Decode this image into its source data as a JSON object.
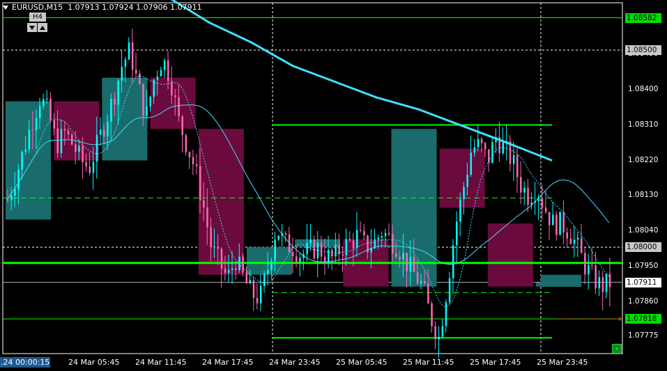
{
  "header": {
    "symbol_timeframe": "EURUSD,M15",
    "ohlc": "1.07913 1.07924 1.07906 1.07911",
    "higher_tf": "H4"
  },
  "price_scale": {
    "labels": [
      "1.08490",
      "1.08400",
      "1.08310",
      "1.08220",
      "1.08130",
      "1.08040",
      "1.07950",
      "1.07860",
      "1.07775"
    ],
    "boxes": [
      {
        "text": "1.08582",
        "price": 1.08582,
        "bg": "#00dd00",
        "fg": "#000000"
      },
      {
        "text": "1.08500",
        "price": 1.085,
        "bg": "#c8c8c8",
        "fg": "#000000"
      },
      {
        "text": "1.08000",
        "price": 1.08,
        "bg": "#c8c8c8",
        "fg": "#000000"
      },
      {
        "text": "1.07911",
        "price": 1.07911,
        "bg": "#ffffff",
        "fg": "#000000"
      },
      {
        "text": "1.07818",
        "price": 1.07818,
        "bg": "#00dd00",
        "fg": "#000000"
      }
    ]
  },
  "time_axis": {
    "left_label": ".24 00:00:15",
    "labels": [
      "24 Mar 05:45",
      "24 Mar 11:45",
      "24 Mar 17:45",
      "24 Mar 23:45",
      "25 Mar 05:45",
      "25 Mar 11:45",
      "25 Mar 17:45",
      "25 Mar 23:45"
    ]
  },
  "colors": {
    "background": "#000000",
    "bull": "#00ffff",
    "bear": "#ff69b4",
    "htf_bull": "#1a6b6b",
    "htf_bear": "#6b0a3c",
    "levels": "#00ff00",
    "ma_slow": "#40e0ff",
    "ma_fast": "#40e0ff",
    "grid": "#ffffff"
  },
  "chart_data": {
    "type": "candlestick",
    "symbol": "EURUSD",
    "timeframe": "M15",
    "ylim": [
      1.0773,
      1.0862
    ],
    "level_lines": [
      1.08582,
      1.07818
    ],
    "zone_lines": [
      1.0831,
      1.0777
    ],
    "support_line": 1.0796,
    "dashed_levels": [
      1.08125,
      1.07885
    ],
    "htf_candles": [
      {
        "o": 1.0807,
        "h": 1.0841,
        "l": 1.0807,
        "c": 1.0837,
        "dir": "bull"
      },
      {
        "o": 1.0837,
        "h": 1.0837,
        "l": 1.0822,
        "c": 1.0822,
        "dir": "bear"
      },
      {
        "o": 1.0822,
        "h": 1.0843,
        "l": 1.0822,
        "c": 1.0843,
        "dir": "bull"
      },
      {
        "o": 1.0843,
        "h": 1.0843,
        "l": 1.083,
        "c": 1.083,
        "dir": "bear"
      },
      {
        "o": 1.083,
        "h": 1.083,
        "l": 1.0793,
        "c": 1.0793,
        "dir": "bear"
      },
      {
        "o": 1.0793,
        "h": 1.08,
        "l": 1.0793,
        "c": 1.08,
        "dir": "bull"
      },
      {
        "o": 1.08,
        "h": 1.0802,
        "l": 1.0799,
        "c": 1.0802,
        "dir": "bull"
      },
      {
        "o": 1.0802,
        "h": 1.0802,
        "l": 1.079,
        "c": 1.079,
        "dir": "bear"
      },
      {
        "o": 1.079,
        "h": 1.083,
        "l": 1.079,
        "c": 1.083,
        "dir": "bull"
      },
      {
        "o": 1.0825,
        "h": 1.0825,
        "l": 1.081,
        "c": 1.081,
        "dir": "bear"
      },
      {
        "o": 1.0806,
        "h": 1.0806,
        "l": 1.079,
        "c": 1.079,
        "dir": "bear"
      },
      {
        "o": 1.079,
        "h": 1.0791,
        "l": 1.0788,
        "c": 1.0791,
        "dir": "bull"
      }
    ],
    "close_path": [
      1.0812,
      1.0818,
      1.0825,
      1.0832,
      1.0838,
      1.0834,
      1.0826,
      1.0829,
      1.0826,
      1.0822,
      1.082,
      1.0826,
      1.0832,
      1.0838,
      1.0846,
      1.085,
      1.0841,
      1.0833,
      1.0843,
      1.0848,
      1.0843,
      1.0832,
      1.0826,
      1.082,
      1.0811,
      1.08,
      1.0796,
      1.0792,
      1.0797,
      1.0792,
      1.0788,
      1.0787,
      1.0795,
      1.0805,
      1.0801,
      1.08,
      1.0798,
      1.0799,
      1.08,
      1.0798,
      1.0797,
      1.08,
      1.0801,
      1.0803,
      1.08,
      1.0801,
      1.0804,
      1.0802,
      1.08,
      1.0796,
      1.0793,
      1.079,
      1.0782,
      1.0777,
      1.079,
      1.0805,
      1.0815,
      1.0825,
      1.0826,
      1.0822,
      1.0828,
      1.0825,
      1.0822,
      1.0816,
      1.0813,
      1.0815,
      1.081,
      1.0806,
      1.0806,
      1.0804,
      1.08,
      1.0795,
      1.0792,
      1.079,
      1.0791
    ]
  }
}
